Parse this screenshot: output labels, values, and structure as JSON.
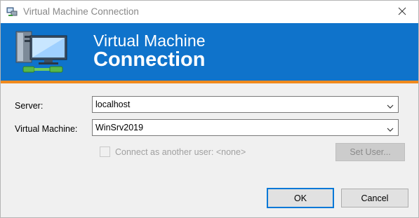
{
  "window": {
    "title": "Virtual Machine Connection"
  },
  "banner": {
    "line1": "Virtual Machine",
    "line2": "Connection"
  },
  "form": {
    "server_label": "Server:",
    "server_value": "localhost",
    "vm_label": "Virtual Machine:",
    "vm_value": "WinSrv2019",
    "connect_other_label": "Connect as another user: <none>",
    "connect_other_checked": false,
    "set_user_label": "Set User..."
  },
  "buttons": {
    "ok": "OK",
    "cancel": "Cancel"
  },
  "colors": {
    "banner_blue": "#0f73cb",
    "banner_stripe": "#f08a1e",
    "default_button_border": "#0078d7"
  },
  "icons": {
    "title_icon": "vm-connect-icon",
    "banner_icon": "computer-network-icon",
    "close": "close-icon",
    "dropdown": "chevron-down-icon"
  }
}
